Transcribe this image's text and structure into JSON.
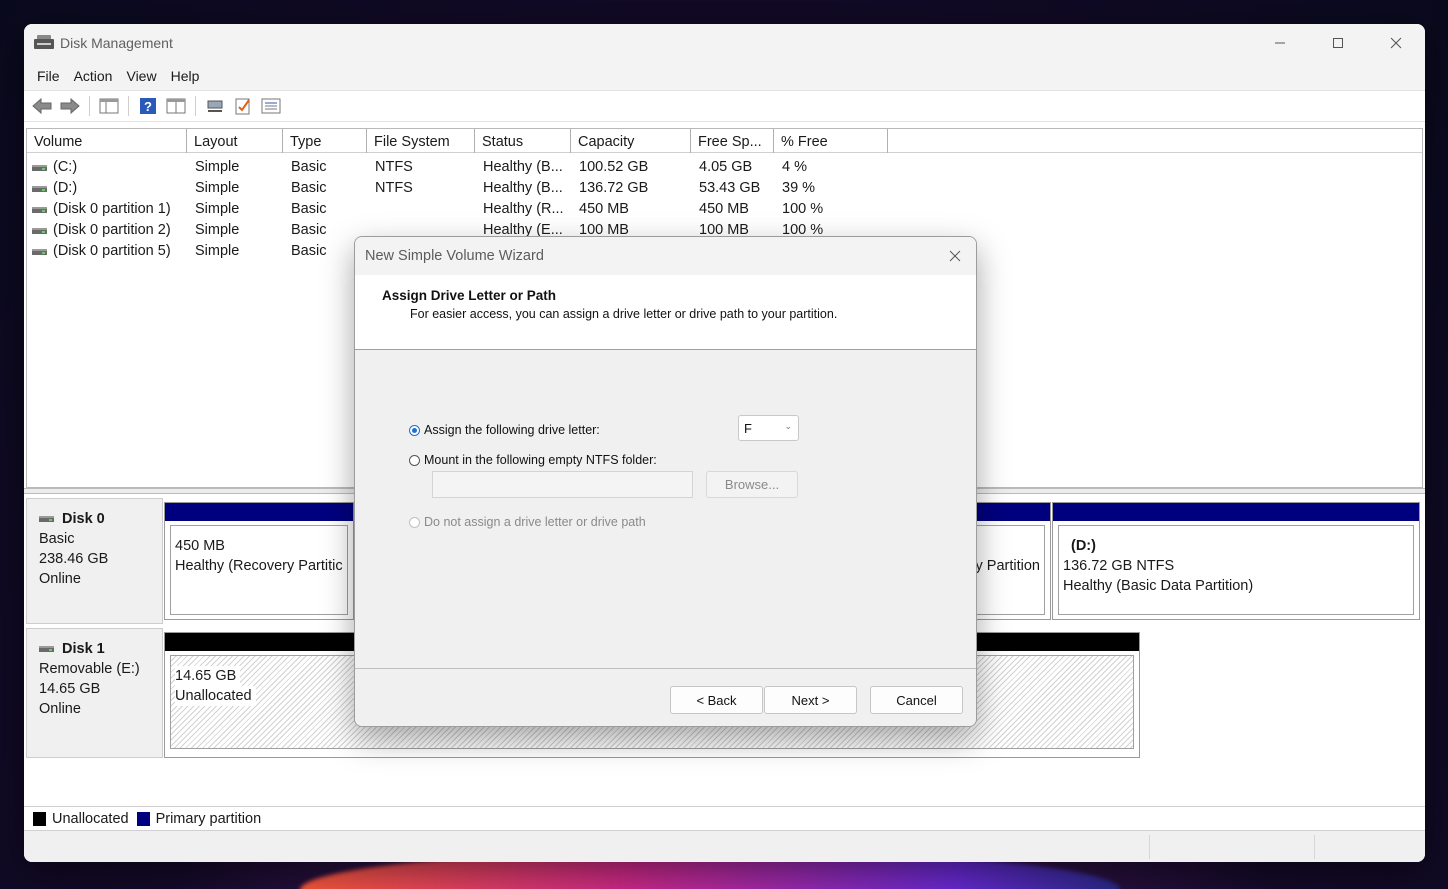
{
  "window": {
    "title": "Disk Management"
  },
  "menu": [
    "File",
    "Action",
    "View",
    "Help"
  ],
  "toolbar_icons": [
    "back-icon",
    "forward-icon",
    "console-tree-icon",
    "help-icon",
    "properties-icon",
    "connect-icon",
    "check-icon",
    "list-view-icon"
  ],
  "volume_list": {
    "columns": [
      "Volume",
      "Layout",
      "Type",
      "File System",
      "Status",
      "Capacity",
      "Free Sp...",
      "% Free"
    ],
    "rows": [
      [
        "(C:)",
        "Simple",
        "Basic",
        "NTFS",
        "Healthy (B...",
        "100.52 GB",
        "4.05 GB",
        "4 %"
      ],
      [
        "(D:)",
        "Simple",
        "Basic",
        "NTFS",
        "Healthy (B...",
        "136.72 GB",
        "53.43 GB",
        "39 %"
      ],
      [
        "(Disk 0 partition 1)",
        "Simple",
        "Basic",
        "",
        "Healthy (R...",
        "450 MB",
        "450 MB",
        "100 %"
      ],
      [
        "(Disk 0 partition 2)",
        "Simple",
        "Basic",
        "",
        "Healthy (E...",
        "100 MB",
        "100 MB",
        "100 %"
      ],
      [
        "(Disk 0 partition 5)",
        "Simple",
        "Basic",
        "",
        "",
        "",
        "",
        ""
      ]
    ]
  },
  "disks": {
    "disk0": {
      "name": "Disk 0",
      "type": "Basic",
      "size": "238.46 GB",
      "status": "Online",
      "partition1": {
        "size": "450 MB",
        "status": "Healthy (Recovery Partitic"
      },
      "partition_mid": {
        "status": "y Partition"
      },
      "partition_d": {
        "name": "(D:)",
        "size": "136.72 GB NTFS",
        "status": "Healthy (Basic Data Partition)"
      }
    },
    "disk1": {
      "name": "Disk 1",
      "type": "Removable (E:)",
      "size": "14.65 GB",
      "status": "Online",
      "partition": {
        "size": "14.65 GB",
        "status": "Unallocated"
      }
    }
  },
  "legend": {
    "unallocated": "Unallocated",
    "primary": "Primary partition"
  },
  "colors": {
    "primary": "#00007f",
    "unallocated": "#000000",
    "radio_accent": "#1e6fd0"
  },
  "dialog": {
    "title": "New Simple Volume Wizard",
    "heading": "Assign Drive Letter or Path",
    "subheading": "For easier access, you can assign a drive letter or drive path to your partition.",
    "option_assign": "Assign the following drive letter:",
    "option_mount": "Mount in the following empty NTFS folder:",
    "option_none": "Do not assign a drive letter or drive path",
    "drive_letter": "F",
    "browse_label": "Browse...",
    "back_label": "< Back",
    "next_label": "Next >",
    "cancel_label": "Cancel"
  }
}
